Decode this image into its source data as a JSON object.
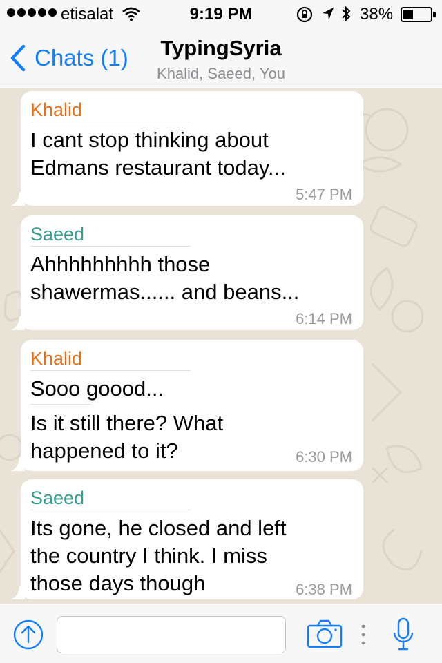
{
  "status_bar": {
    "carrier": "etisalat",
    "time": "9:19 PM",
    "battery_percent": "38%",
    "battery_level": 0.38,
    "signal_bars": 5
  },
  "nav": {
    "back_label": "Chats (1)",
    "title": "TypingSyria",
    "subtitle": "Khalid, Saeed, You"
  },
  "messages": [
    {
      "sender": "Khalid",
      "lines": [
        "I cant stop thinking about",
        "Edmans restaurant today..."
      ],
      "time": "5:47 PM"
    },
    {
      "sender": "Saeed",
      "lines": [
        "Ahhhhhhhhh those",
        "shawermas...... and beans..."
      ],
      "time": "6:14 PM"
    },
    {
      "sender": "Khalid",
      "lines": [
        "Sooo goood...",
        "Is it still there? What",
        "happened to it?"
      ],
      "time": "6:30 PM"
    },
    {
      "sender": "Saeed",
      "lines": [
        "Its gone, he closed and left",
        "the country I think.  I miss",
        "those days though"
      ],
      "time": "6:38 PM"
    }
  ],
  "input": {
    "placeholder": "",
    "value": ""
  },
  "colors": {
    "accent": "#157efb",
    "khalid": "#e2711d",
    "saeed": "#3a9c8f",
    "chat_background": "#e9e2d6"
  },
  "icons": [
    "chevron-left-icon",
    "wifi-icon",
    "rotation-lock-icon",
    "location-arrow-icon",
    "bluetooth-icon",
    "battery-icon",
    "upload-arrow-icon",
    "camera-icon",
    "more-dots-icon",
    "microphone-icon"
  ]
}
